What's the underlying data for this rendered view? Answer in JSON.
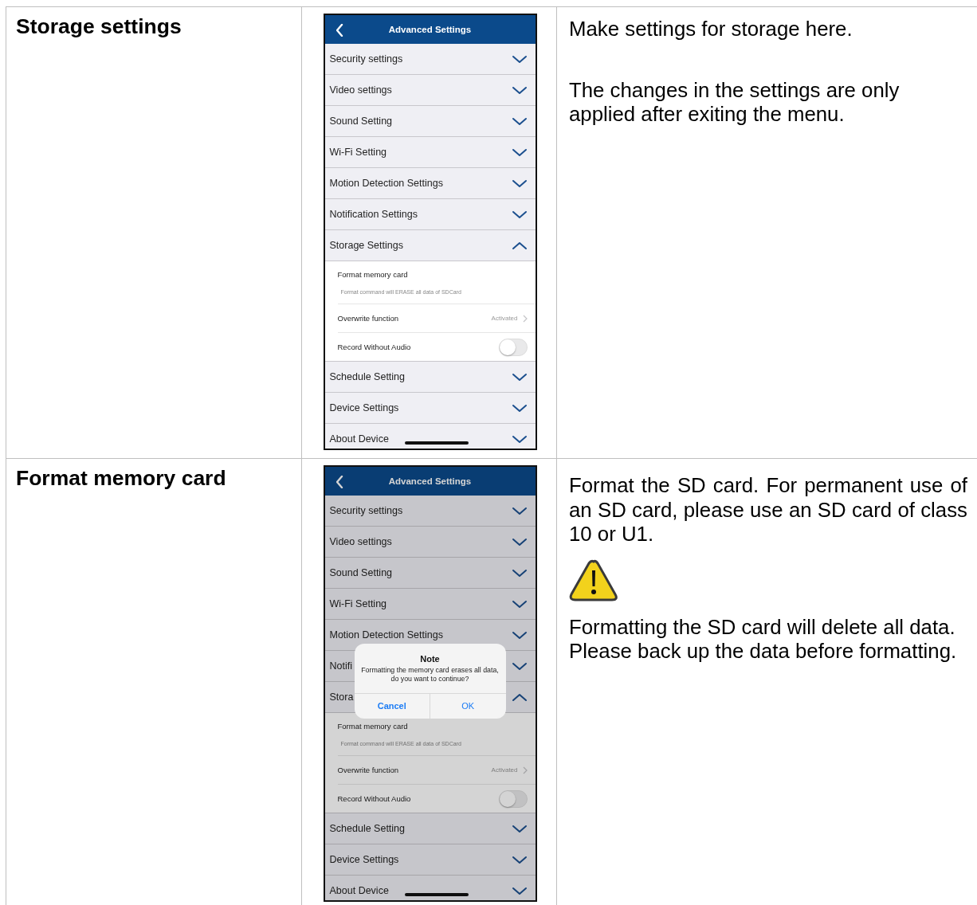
{
  "rows": [
    {
      "title": "Storage settings",
      "phone": {
        "header": {
          "title": "Advanced Settings"
        },
        "sections": [
          {
            "label": "Security settings",
            "expanded": false
          },
          {
            "label": "Video settings",
            "expanded": false
          },
          {
            "label": "Sound Setting",
            "expanded": false
          },
          {
            "label": "Wi-Fi Setting",
            "expanded": false
          },
          {
            "label": "Motion Detection Settings",
            "expanded": false
          },
          {
            "label": "Notification Settings",
            "expanded": false
          },
          {
            "label": "Storage Settings",
            "expanded": true,
            "children": [
              {
                "kind": "action",
                "label": "Format memory card",
                "hint": "Format command will ERASE all data of SDCard"
              },
              {
                "kind": "link",
                "label": "Overwrite function",
                "value": "Activated"
              },
              {
                "kind": "toggle",
                "label": "Record Without Audio",
                "on": false
              }
            ]
          },
          {
            "label": "Schedule Setting",
            "expanded": false
          },
          {
            "label": "Device Settings",
            "expanded": false
          },
          {
            "label": "About Device",
            "expanded": false
          }
        ]
      },
      "description": [
        {
          "kind": "text",
          "text": "Make settings for storage here."
        },
        {
          "kind": "text",
          "text": "The changes in the settings are only applied after exiting the menu.",
          "justified": false
        }
      ]
    },
    {
      "title": "Format memory card",
      "phone": {
        "header": {
          "title": "Advanced Settings"
        },
        "sections": [
          {
            "label": "Security settings",
            "expanded": false
          },
          {
            "label": "Video settings",
            "expanded": false
          },
          {
            "label": "Sound Setting",
            "expanded": false
          },
          {
            "label": "Wi-Fi Setting",
            "expanded": false
          },
          {
            "label": "Motion Detection Settings",
            "expanded": false
          },
          {
            "label": "Notifi",
            "expanded": false
          },
          {
            "label": "Stora",
            "expanded": true,
            "children": [
              {
                "kind": "action",
                "label": "Format memory card",
                "hint": "Format command will ERASE all data of SDCard"
              },
              {
                "kind": "link",
                "label": "Overwrite function",
                "value": "Activated"
              },
              {
                "kind": "toggle",
                "label": "Record Without Audio",
                "on": false
              }
            ]
          },
          {
            "label": "Schedule Setting",
            "expanded": false
          },
          {
            "label": "Device Settings",
            "expanded": false
          },
          {
            "label": "About Device",
            "expanded": false
          }
        ],
        "dialog": {
          "title": "Note",
          "message": "Formatting the memory card erases all data, do you want to continue?",
          "buttons": [
            {
              "label": "Cancel",
              "bold": true
            },
            {
              "label": "OK",
              "bold": false
            }
          ]
        }
      },
      "description": [
        {
          "kind": "text",
          "text": "Format the SD card. For permanent use of an SD card, please use an SD card of class 10 or U1.",
          "justified": true
        },
        {
          "kind": "warning"
        },
        {
          "kind": "text",
          "text": "Formatting the SD card will delete all data. Please back up the data before formatting.",
          "justified": false
        }
      ]
    }
  ]
}
